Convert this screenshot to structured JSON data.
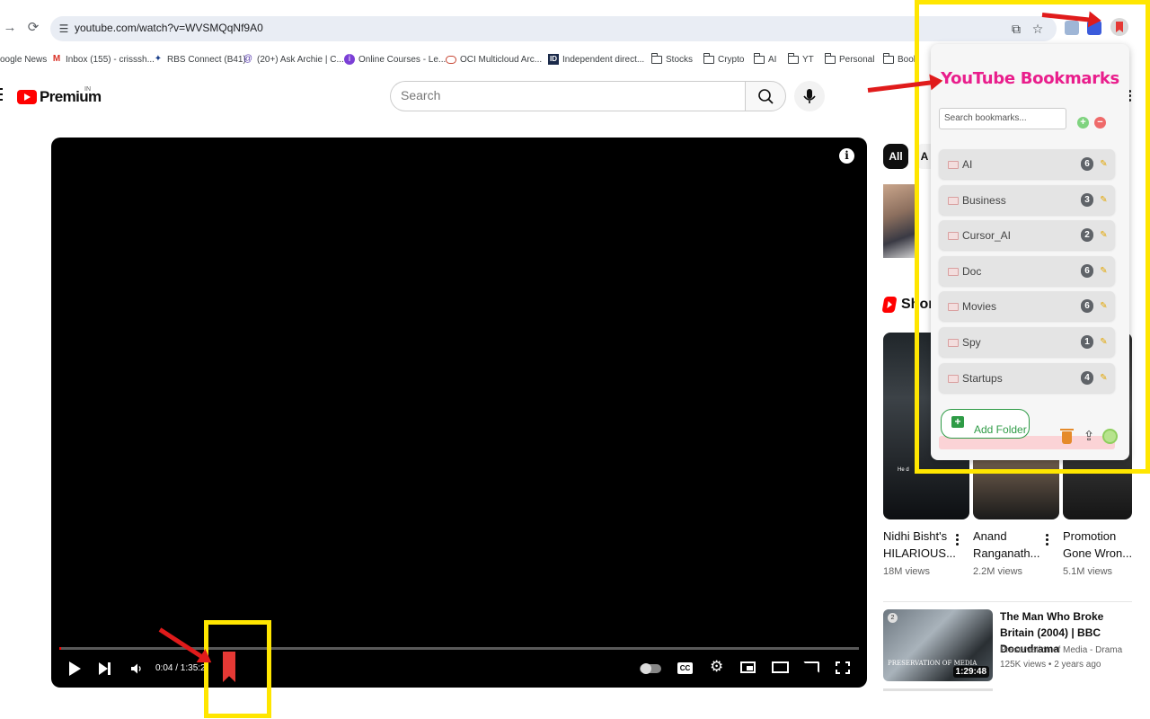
{
  "browser": {
    "url": "youtube.com/watch?v=WVSMQqNf9A0",
    "bookmarks": [
      {
        "label": "oogle News",
        "icon": "google-news-icon"
      },
      {
        "label": "Inbox (155) - crisssh...",
        "icon": "gmail-icon"
      },
      {
        "label": "RBS Connect (B41)",
        "icon": "rbs-icon"
      },
      {
        "label": "(20+) Ask Archie | C...",
        "icon": "archie-icon"
      },
      {
        "label": "Online Courses - Le...",
        "icon": "courses-icon"
      },
      {
        "label": "OCI Multicloud Arc...",
        "icon": "oracle-icon"
      },
      {
        "label": "Independent direct...",
        "icon": "id-icon"
      },
      {
        "label": "Stocks",
        "icon": "folder-icon"
      },
      {
        "label": "Crypto",
        "icon": "folder-icon"
      },
      {
        "label": "AI",
        "icon": "folder-icon"
      },
      {
        "label": "YT",
        "icon": "folder-icon"
      },
      {
        "label": "Personal",
        "icon": "folder-icon"
      },
      {
        "label": "Bool",
        "icon": "folder-icon"
      }
    ]
  },
  "youtube": {
    "logo_text": "Premium",
    "country_code": "IN",
    "search_placeholder": "Search"
  },
  "player": {
    "info_label": "i",
    "time": "0:04 / 1:35:2",
    "progress": 0.001,
    "cc_label": "CC"
  },
  "sidebar": {
    "chips": [
      {
        "label": "All"
      },
      {
        "label": "A"
      }
    ],
    "shorts_label": "Shor",
    "shorts": [
      {
        "title": "Nidhi Bisht's HILARIOUS...",
        "views": "18M views",
        "subtitle_hint": "He d"
      },
      {
        "title": "Anand Ranganath...",
        "views": "2.2M views",
        "subtitle_hint": ""
      },
      {
        "title": "Promotion Gone Wron...",
        "views": "5.1M views",
        "subtitle_hint": ""
      }
    ],
    "recommended": {
      "title": "The Man Who Broke Britain (2004) | BBC Docudrama",
      "channel": "Preservation of Media - Drama",
      "meta": "125K views  •  2 years ago",
      "duration": "1:29:48",
      "badge": "2",
      "watermark": "PRESERVATION OF MEDIA"
    }
  },
  "extension": {
    "title": "YouTube Bookmarks",
    "search_placeholder": "Search bookmarks...",
    "add_symbol": "+",
    "remove_symbol": "−",
    "folders": [
      {
        "name": "AI",
        "count": "6"
      },
      {
        "name": "Business",
        "count": "3"
      },
      {
        "name": "Cursor_AI",
        "count": "2"
      },
      {
        "name": "Doc",
        "count": "6"
      },
      {
        "name": "Movies",
        "count": "6"
      },
      {
        "name": "Spy",
        "count": "1"
      },
      {
        "name": "Startups",
        "count": "4"
      }
    ],
    "add_folder_label": "Add Folder",
    "add_folder_symbol": "+"
  },
  "colors": {
    "youtube_red": "#ff0000",
    "extension_title": "#e91e8c",
    "highlight": "#ffe600",
    "arrow": "#e01b1b",
    "add_folder_green": "#2e9b46"
  }
}
